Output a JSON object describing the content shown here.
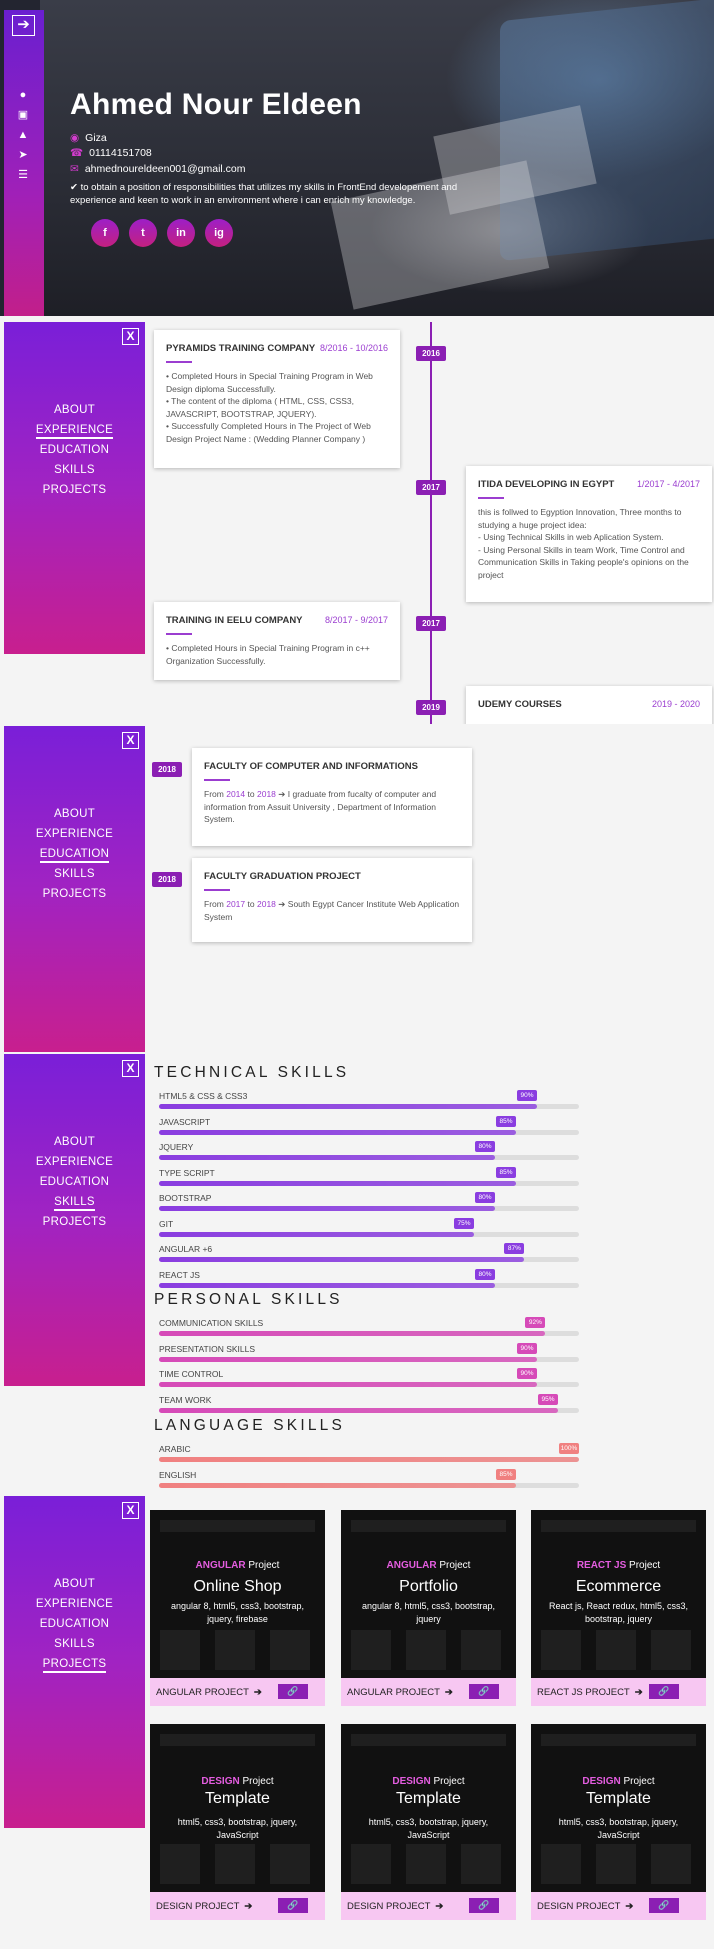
{
  "hero": {
    "name": "Ahmed Nour Eldeen",
    "location": "Giza",
    "phone": "01114151708",
    "email": "ahmednoureldeen001@gmail.com",
    "objective": "to obtain a position of responsibilities that utilizes my skills in FrontEnd developement and experience and keen to work in an environment where i can enrich my knowledge.",
    "toggle_icon": "arrow-right-icon",
    "rail_icons": [
      "user-icon",
      "id-card-icon",
      "graduation-cap-icon",
      "rocket-icon",
      "list-icon"
    ],
    "socials": [
      "f",
      "t",
      "in",
      "ig"
    ]
  },
  "nav": {
    "close": "X",
    "items": [
      "ABOUT",
      "EXPERIENCE",
      "EDUCATION",
      "SKILLS",
      "PROJECTS"
    ]
  },
  "experience": {
    "items": [
      {
        "title": "PYRAMIDS TRAINING COMPANY",
        "date": "8/2016 - 10/2016",
        "year": "2016",
        "lines": [
          "• Completed Hours in Special Training Program in Web",
          "Design diploma Successfully.",
          "• The content of the diploma ( HTML, CSS, CSS3,",
          "JAVASCRIPT, BOOTSTRAP, JQUERY).",
          "• Successfully Completed Hours in The Project of Web",
          "Design Project Name : (Wedding Planner Company )"
        ]
      },
      {
        "title": "ITIDA DEVELOPING IN EGYPT",
        "date": "1/2017 - 4/2017",
        "year": "2017",
        "lines": [
          "this is follwed to Egyption Innovation, Three months to",
          "studying a huge project idea:",
          "- Using Technical Skills in web Aplication System.",
          "- Using Personal Skills in team Work, Time Control and",
          "Communication Skills in Taking people's opinions on the",
          "project"
        ]
      },
      {
        "title": "TRAINING IN EELU COMPANY",
        "date": "8/2017 - 9/2017",
        "year": "2017",
        "lines": [
          "• Completed Hours in Special Training Program in c++",
          "Organization Successfully."
        ]
      },
      {
        "title": "UDEMY COURSES",
        "date": "2019 - 2020",
        "year": "2019",
        "lines": []
      }
    ]
  },
  "education": {
    "items": [
      {
        "year": "2018",
        "title": "FACULTY OF COMPUTER AND INFORMATIONS",
        "from_label": "From",
        "from": "2014",
        "to_label": "to",
        "to": "2018",
        "text": "I graduate from fucalty of computer and",
        "text2": "information from Assuit University , Department of Information",
        "text3": "System."
      },
      {
        "year": "2018",
        "title": "FACULTY GRADUATION PROJECT",
        "from_label": "From",
        "from": "2017",
        "to_label": "to",
        "to": "2018",
        "text": "South Egypt Cancer Institute Web Application",
        "text2": "System",
        "text3": ""
      }
    ]
  },
  "skills": {
    "technical_heading": "TECHNICAL SKILLS",
    "personal_heading": "PERSONAL SKILLS",
    "language_heading": "LANGUAGE SKILLS",
    "technical": [
      {
        "name": "HTML5 & CSS & CSS3",
        "label": "90%",
        "value": 0.9
      },
      {
        "name": "JAVASCRIPT",
        "label": "85%",
        "value": 0.85
      },
      {
        "name": "JQUERY",
        "label": "80%",
        "value": 0.8
      },
      {
        "name": "TYPE SCRIPT",
        "label": "85%",
        "value": 0.85
      },
      {
        "name": "BOOTSTRAP",
        "label": "80%",
        "value": 0.8
      },
      {
        "name": "GIT",
        "label": "75%",
        "value": 0.75
      },
      {
        "name": "ANGULAR +6",
        "label": "87%",
        "value": 0.87
      },
      {
        "name": "REACT JS",
        "label": "80%",
        "value": 0.8
      }
    ],
    "personal": [
      {
        "name": "COMMUNICATION SKILLS",
        "label": "92%",
        "value": 0.92
      },
      {
        "name": "PRESENTATION SKILLS",
        "label": "90%",
        "value": 0.9
      },
      {
        "name": "TIME CONTROL",
        "label": "90%",
        "value": 0.9
      },
      {
        "name": "TEAM WORK",
        "label": "95%",
        "value": 0.95
      }
    ],
    "language": [
      {
        "name": "ARABIC",
        "label": "100%",
        "value": 1.0
      },
      {
        "name": "ENGLISH",
        "label": "85%",
        "value": 0.85
      }
    ],
    "colors": {
      "technical": "#8a3de0",
      "personal": "#d64ab8",
      "language": "#f08080"
    }
  },
  "projects": {
    "items": [
      {
        "kind": "ANGULAR",
        "suffix": "Project",
        "title": "Online Shop",
        "desc": "angular 8, html5, css3, bootstrap, jquery, firebase",
        "bar": "ANGULAR PROJECT"
      },
      {
        "kind": "ANGULAR",
        "suffix": "Project",
        "title": "Portfolio",
        "desc": "angular 8, html5, css3, bootstrap, jquery",
        "bar": "ANGULAR PROJECT"
      },
      {
        "kind": "REACT JS",
        "suffix": "Project",
        "title": "Ecommerce",
        "desc": "React js, React redux, html5, css3, bootstrap, jquery",
        "bar": "REACT JS PROJECT"
      },
      {
        "kind": "DESIGN",
        "suffix": "Project",
        "title": "Template",
        "desc": "html5, css3, bootstrap, jquery, JavaScript",
        "bar": "DESIGN PROJECT"
      },
      {
        "kind": "DESIGN",
        "suffix": "Project",
        "title": "Template",
        "desc": "html5, css3, bootstrap, jquery, JavaScript",
        "bar": "DESIGN PROJECT"
      },
      {
        "kind": "DESIGN",
        "suffix": "Project",
        "title": "Template",
        "desc": "html5, css3, bootstrap, jquery, JavaScript",
        "bar": "DESIGN PROJECT"
      }
    ],
    "arrow_icon": "arrow-right-icon",
    "link_icon": "link-icon"
  }
}
